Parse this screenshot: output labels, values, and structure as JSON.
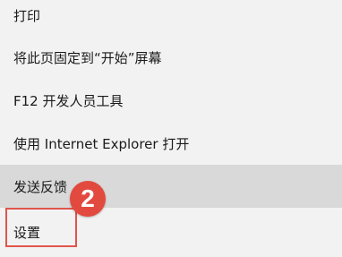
{
  "menu": {
    "items": [
      {
        "label": "打印"
      },
      {
        "label": "将此页固定到“开始”屏幕"
      },
      {
        "label": "F12 开发人员工具"
      },
      {
        "label": "使用 Internet Explorer 打开"
      },
      {
        "label": "发送反馈",
        "state": "hover"
      },
      {
        "label": "设置",
        "state": "highlighted"
      }
    ]
  },
  "annotation": {
    "step_number": "2",
    "color": "#e24a3f"
  }
}
